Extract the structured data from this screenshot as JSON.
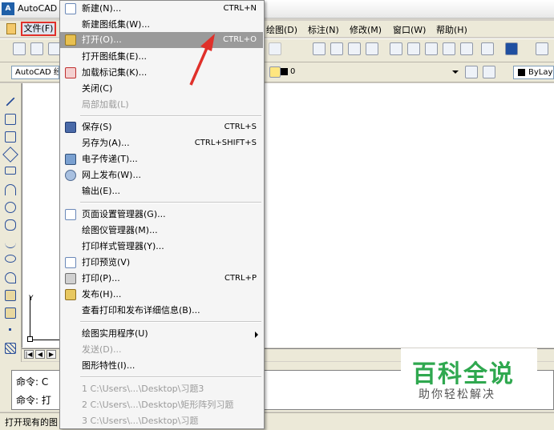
{
  "title": "AutoCAD 2",
  "menubar": {
    "file": "文件(F)",
    "items": [
      "绘图(D)",
      "标注(N)",
      "修改(M)",
      "窗口(W)",
      "帮助(H)"
    ]
  },
  "toolbar": {
    "style_combo": "AutoCAD 经",
    "layer_combo": "0",
    "color_combo": "ByLay"
  },
  "ucs_label": "Y",
  "menu": {
    "new": {
      "label": "新建(N)...",
      "shortcut": "CTRL+N"
    },
    "new_sheetset": {
      "label": "新建图纸集(W)..."
    },
    "open": {
      "label": "打开(O)...",
      "shortcut": "CTRL+O"
    },
    "open_sheetset": {
      "label": "打开图纸集(E)..."
    },
    "load_markup": {
      "label": "加载标记集(K)..."
    },
    "close": {
      "label": "关闭(C)"
    },
    "partial_load": {
      "label": "局部加载(L)"
    },
    "save": {
      "label": "保存(S)",
      "shortcut": "CTRL+S"
    },
    "save_as": {
      "label": "另存为(A)...",
      "shortcut": "CTRL+SHIFT+S"
    },
    "etransmit": {
      "label": "电子传递(T)..."
    },
    "publish_web": {
      "label": "网上发布(W)..."
    },
    "export": {
      "label": "输出(E)..."
    },
    "page_setup": {
      "label": "页面设置管理器(G)..."
    },
    "plotter_mgr": {
      "label": "绘图仪管理器(M)..."
    },
    "plot_style_mgr": {
      "label": "打印样式管理器(Y)..."
    },
    "plot_preview": {
      "label": "打印预览(V)"
    },
    "plot": {
      "label": "打印(P)...",
      "shortcut": "CTRL+P"
    },
    "publish": {
      "label": "发布(H)..."
    },
    "view_details": {
      "label": "查看打印和发布详细信息(B)..."
    },
    "drawing_utilities": {
      "label": "绘图实用程序(U)"
    },
    "send": {
      "label": "发送(D)..."
    },
    "drawing_properties": {
      "label": "图形特性(I)..."
    },
    "recent": [
      "1 C:\\Users\\...\\Desktop\\习题3",
      "2 C:\\Users\\...\\Desktop\\矩形阵列习题",
      "3 C:\\Users\\...\\Desktop\\习题"
    ]
  },
  "command": {
    "line1": "命令: C",
    "line2": "命令: 打"
  },
  "status_text": "打开现有的图",
  "watermark": {
    "title": "百科全说",
    "subtitle": "助你轻松解决"
  },
  "colors": {
    "highlight": "#9a9a9a",
    "annotation": "#e0302a",
    "watermark": "#2fa84f"
  }
}
